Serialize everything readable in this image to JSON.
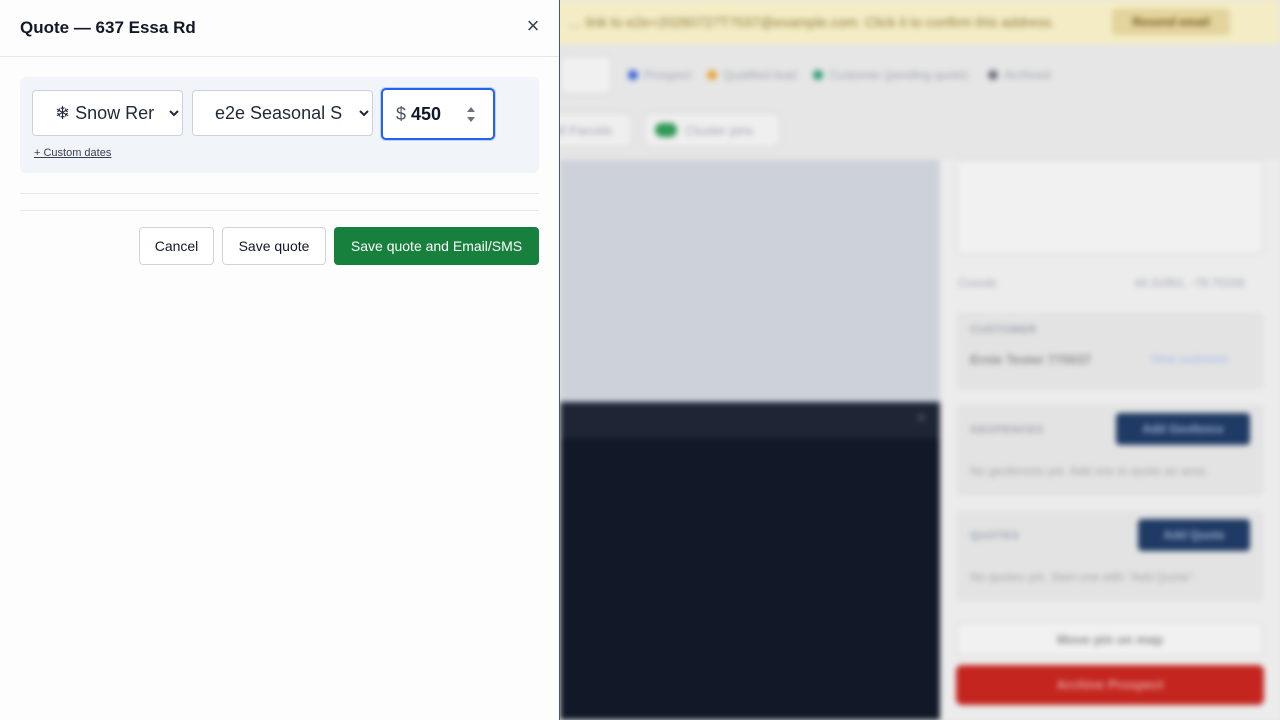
{
  "panel": {
    "title": "Quote — 637 Essa Rd",
    "close_symbol": "×",
    "line_item": {
      "service_selected": "❄ Snow Rer",
      "plan_selected": "e2e Seasonal S",
      "currency_symbol": "$",
      "price_value": "450",
      "custom_dates_link": "+ Custom dates"
    },
    "buttons": {
      "cancel": "Cancel",
      "save": "Save quote",
      "save_and_send": "Save quote and Email/SMS"
    }
  },
  "background": {
    "banner_text": "… link to e2e+20260727T7037@example.com. Click it to confirm this address.",
    "banner_button": "Resend email",
    "legend": [
      {
        "label": "Prospect",
        "color": "#3b63d9"
      },
      {
        "label": "Qualified lead",
        "color": "#e8a33d"
      },
      {
        "label": "Customer (pending quote)",
        "color": "#2e9a78"
      },
      {
        "label": "Archived",
        "color": "#6b7280"
      }
    ],
    "chips": {
      "parcels": "All Parcels",
      "cluster": "Cluster pins"
    },
    "coords_label": "Coords",
    "coords_value": "44.31951, -79.70156",
    "customer_title": "CUSTOMER",
    "customer_name": "Ernie Tester 770037",
    "view_customer": "View customer",
    "geofences_title": "GEOFENCES",
    "geofences_button": "Add Geofence",
    "geofences_empty": "No geofences yet. Add one to quote an area.",
    "quotes_title": "QUOTES",
    "quotes_button": "Add Quote",
    "quotes_empty": "No quotes yet. Start one with \"Add Quote\".",
    "move_pin": "Move pin on map",
    "archive": "Archive Prospect",
    "dark_close": "×"
  }
}
